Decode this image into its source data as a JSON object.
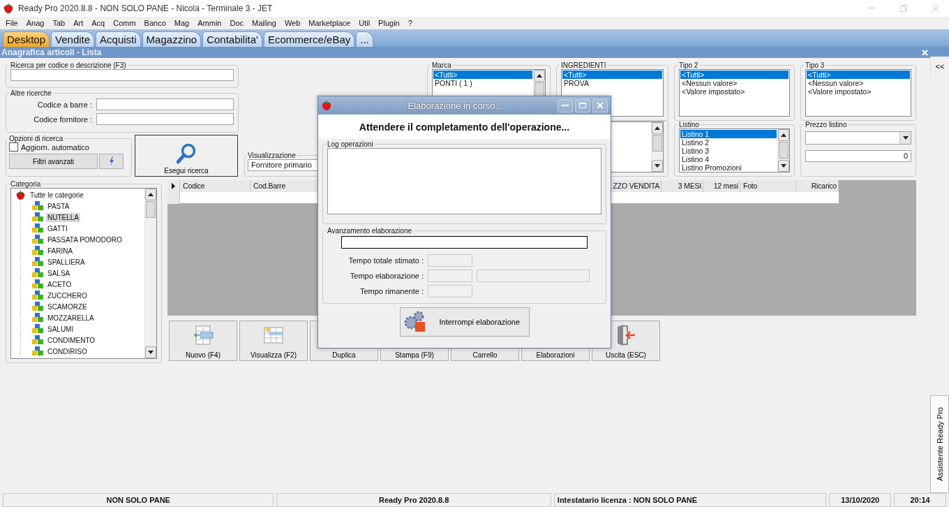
{
  "window": {
    "title": "Ready Pro 2020.8.8 - NON SOLO PANE - Nicola - Terminale 3 - JET"
  },
  "menu": [
    "File",
    "Anag",
    "Tab",
    "Art",
    "Acq",
    "Comm",
    "Banco",
    "Mag",
    "Ammin",
    "Doc",
    "Mailing",
    "Web",
    "Marketplace",
    "Util",
    "Plugin",
    "?"
  ],
  "tabs": [
    {
      "label": "Desktop",
      "selected": true
    },
    {
      "label": "Vendite",
      "selected": false
    },
    {
      "label": "Acquisti",
      "selected": false
    },
    {
      "label": "Magazzino",
      "selected": false
    },
    {
      "label": "Contabilita'",
      "selected": false
    },
    {
      "label": "Ecommerce/eBay",
      "selected": false
    },
    {
      "label": "...",
      "selected": false
    }
  ],
  "page_title": "Anagrafica articoli  - Lista",
  "search": {
    "label": "Ricerca per codice o descrizione (F3)"
  },
  "other_searches": {
    "label": "Altre ricerche",
    "fields": [
      {
        "label": "Codice a barre :"
      },
      {
        "label": "Codice fornitore :"
      }
    ]
  },
  "search_options": {
    "label": "Opzioni di ricerca",
    "auto_update": {
      "label": "Aggiorn. automatico",
      "checked": false
    },
    "advanced_button": "Filtri avanzati"
  },
  "run_search_button": "Esegui ricerca",
  "view": {
    "label": "Visualizzazione",
    "value": "Fornitore primario"
  },
  "filters": [
    {
      "label": "Marca",
      "scroll": true,
      "items": [
        {
          "text": "<Tutti>",
          "selected": true
        },
        {
          "text": "PONTI ( 1 )",
          "selected": false
        }
      ]
    },
    {
      "label": "INGREDIENTI",
      "scroll": false,
      "items": [
        {
          "text": "<Tutti>",
          "selected": true
        },
        {
          "text": "PROVA",
          "selected": false
        }
      ]
    },
    {
      "label": "Tipo 2",
      "scroll": false,
      "items": [
        {
          "text": "<Tutti>",
          "selected": true
        },
        {
          "text": "<Nessun valore>",
          "selected": false
        },
        {
          "text": "<Valore impostato>",
          "selected": false
        }
      ]
    },
    {
      "label": "Tipo 3",
      "scroll": false,
      "items": [
        {
          "text": "<Tutti>",
          "selected": true
        },
        {
          "text": "<Nessun valore>",
          "selected": false
        },
        {
          "text": "<Valore impostato>",
          "selected": false
        }
      ]
    }
  ],
  "price_lists": {
    "label": "Listino",
    "items": [
      {
        "text": "Listino 1",
        "selected": true
      },
      {
        "text": "Listino 2",
        "selected": false
      },
      {
        "text": "Listino 3",
        "selected": false
      },
      {
        "text": "Listino 4",
        "selected": false
      },
      {
        "text": "Listino Promozioni",
        "selected": false
      }
    ]
  },
  "list_price": {
    "label": "Prezzo listino",
    "value": "0"
  },
  "categories": {
    "label": "Categoria",
    "root": "Tutte le categorie",
    "children": [
      {
        "text": "PASTA",
        "selected": false
      },
      {
        "text": "NUTELLA",
        "selected": true
      },
      {
        "text": "GATTI",
        "selected": false
      },
      {
        "text": "PASSATA POMODORO",
        "selected": false
      },
      {
        "text": "FARINA",
        "selected": false
      },
      {
        "text": "SPALLIERA",
        "selected": false
      },
      {
        "text": "SALSA",
        "selected": false
      },
      {
        "text": "ACETO",
        "selected": false
      },
      {
        "text": "ZUCCHERO",
        "selected": false
      },
      {
        "text": "SCAMORZE",
        "selected": false
      },
      {
        "text": "MOZZARELLA",
        "selected": false
      },
      {
        "text": "SALUMI",
        "selected": false
      },
      {
        "text": "CONDIMENTO",
        "selected": false
      },
      {
        "text": "CONDIRISO",
        "selected": false
      }
    ]
  },
  "table": {
    "columns": [
      "Codice",
      "Cod.Barre",
      "ZZO VENDITA",
      "3 MESI",
      "12 mesi",
      "Foto",
      "Ricarico"
    ]
  },
  "actions": [
    "Nuovo (F4)",
    "Visualizza (F2)",
    "Duplica",
    "Stampa (F9)",
    "Carrello",
    "Elaborazioni",
    "Uscita (ESC)"
  ],
  "side_panel": {
    "collapse_button": "<<",
    "tab": "Assistente Ready Pro"
  },
  "dialog": {
    "title": "Elaborazione in corso...",
    "heading": "Attendere il completamento dell'operazione...",
    "log_label": "Log operazioni",
    "progress_label": "Avanzamento elaborazione",
    "progress": {
      "level": 0
    },
    "times": [
      {
        "label": "Tempo totale stimato :",
        "kind": "single"
      },
      {
        "label": "Tempo elaborazione :",
        "kind": "double"
      },
      {
        "label": "Tempo rimanente :",
        "kind": "single"
      }
    ],
    "stop_button": "Interrompi elaborazione"
  },
  "status_bar": [
    {
      "text": "NON SOLO PANE",
      "kind": "center"
    },
    {
      "text": "Ready Pro 2020.8.8",
      "kind": "center"
    },
    {
      "text": "Intestatario licenza : NON SOLO PANE",
      "kind": "left"
    },
    {
      "text": "13/10/2020",
      "kind": "center"
    },
    {
      "text": "20:14",
      "kind": "center"
    }
  ]
}
